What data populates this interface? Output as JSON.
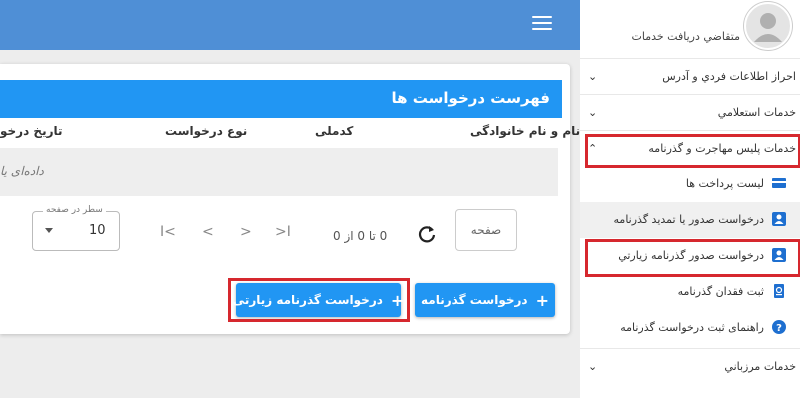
{
  "header": {
    "menu_icon": "hamburger-icon"
  },
  "card": {
    "title": "فهرست درخواست ها",
    "columns": [
      "نام و نام خانوادگی",
      "کدملی",
      "نوع درخواست",
      "تاریخ درخو"
    ],
    "empty_text": "داده‌ای یا",
    "pagination": {
      "page_label": "صفحه",
      "range_text": "0 تا 0 از 0",
      "first": "I<",
      "prev": "<",
      "next": ">",
      "last": ">I",
      "rows_legend": "سطر در صفحه",
      "rows_value": "10"
    }
  },
  "buttons": {
    "passport_request": "درخواست گذرنامه",
    "pilgrim_passport_request": "درخواست گذرنامه زیارتی",
    "plus": "+"
  },
  "sidebar": {
    "profile_name": "متقاضي دريافت خدمات",
    "items": [
      {
        "label": "احراز اطلاعات فردي و آدرس",
        "chevron": "⌄"
      },
      {
        "label": "خدمات استعلامي",
        "chevron": "⌄"
      },
      {
        "label": "خدمات پلیس مهاجرت و گذرنامه",
        "chevron": "⌃"
      }
    ],
    "subitems": [
      {
        "label": "لیست پرداخت ها",
        "icon": "card-icon"
      },
      {
        "label": "درخواست صدور یا تمدید گذرنامه",
        "icon": "person-badge-icon"
      },
      {
        "label": "درخواست صدور گذرنامه زیارتي",
        "icon": "person-badge-icon"
      },
      {
        "label": "ثبت فقدان گذرنامه",
        "icon": "passport-icon"
      },
      {
        "label": "راهنمای ثبت درخواست گذرنامه",
        "icon": "help-icon"
      }
    ],
    "border_item": {
      "label": "خدمات مرزباني",
      "chevron": "⌄"
    }
  },
  "colors": {
    "primary": "#2196f3",
    "topbar": "#4f8fd6",
    "highlight": "#d6282e"
  }
}
